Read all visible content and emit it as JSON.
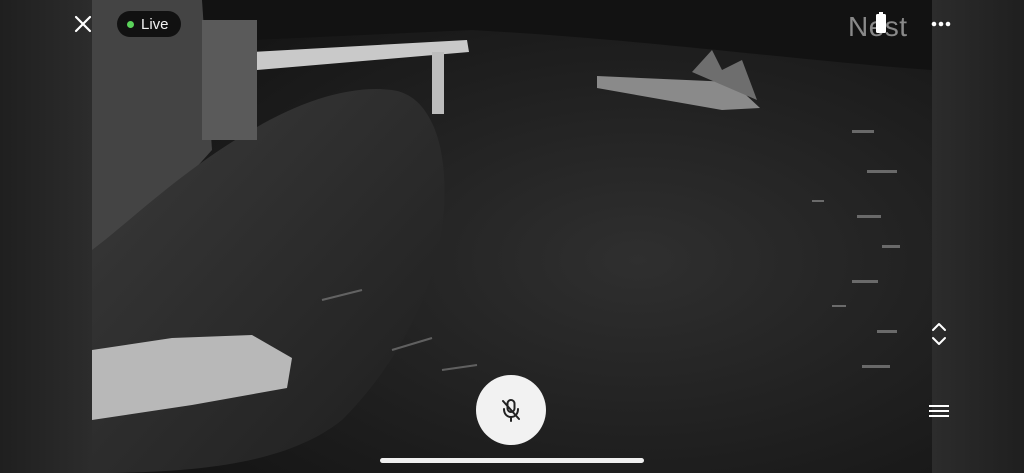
{
  "live_label": "Live",
  "watermark": "Nest",
  "icons": {
    "close": "close-icon",
    "battery": "battery-icon",
    "more": "more-vertical-dots-icon",
    "expand": "chevron-up-down-icon",
    "menu": "hamburger-menu-icon",
    "mic": "microphone-off-icon"
  },
  "colors": {
    "live_dot": "#5ad35a",
    "mic_button": "#f2f2f2"
  }
}
